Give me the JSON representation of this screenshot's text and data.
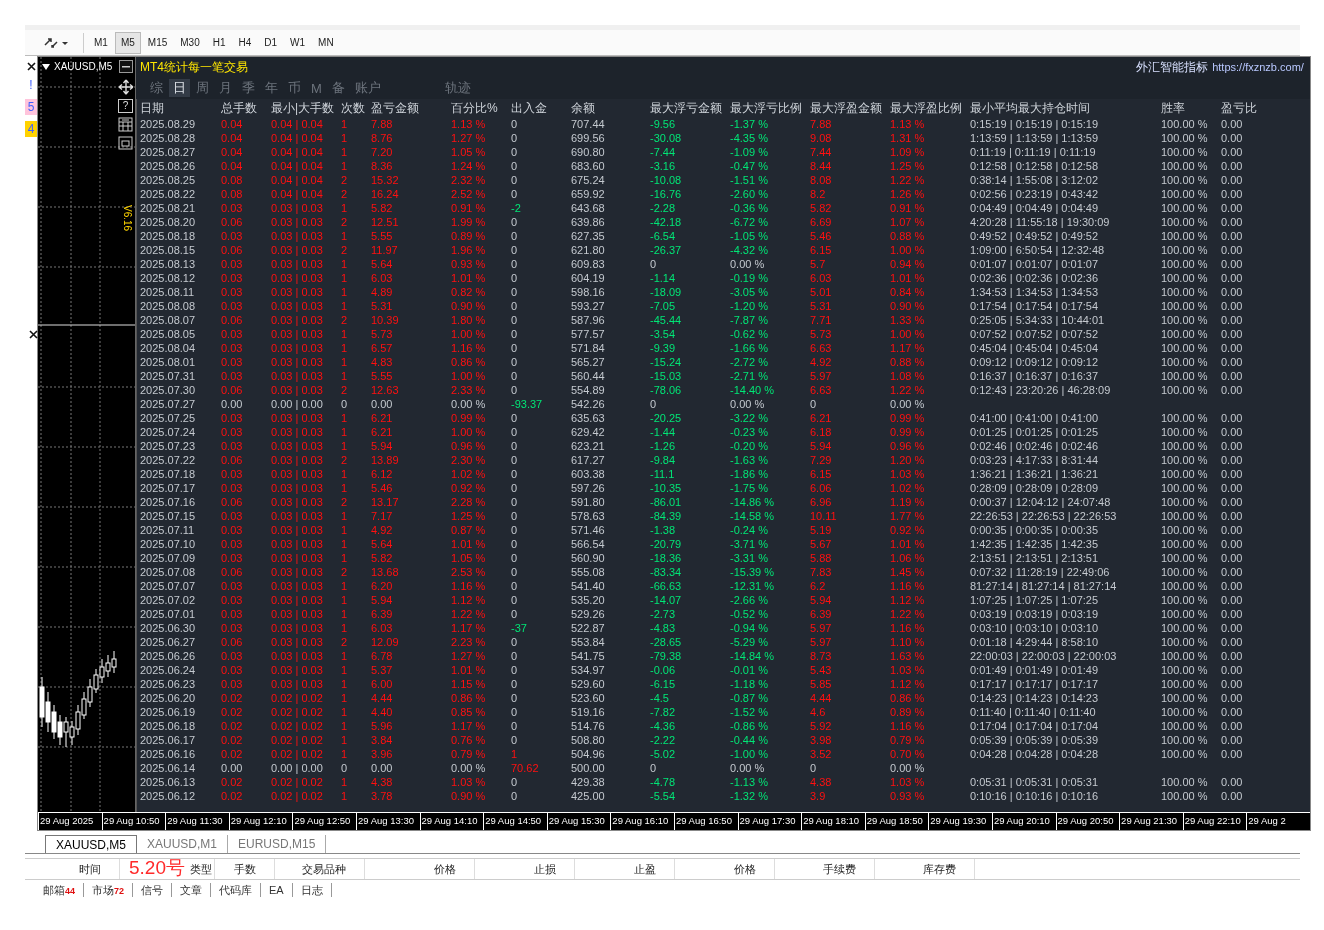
{
  "toolbar": {
    "timeframes": [
      {
        "label": "M1",
        "selected": false
      },
      {
        "label": "M5",
        "selected": true
      },
      {
        "label": "M15",
        "selected": false
      },
      {
        "label": "M30",
        "selected": false
      },
      {
        "label": "H1",
        "selected": false
      },
      {
        "label": "H4",
        "selected": false
      },
      {
        "label": "D1",
        "selected": false
      },
      {
        "label": "W1",
        "selected": false
      },
      {
        "label": "MN",
        "selected": false
      }
    ]
  },
  "side_markers": [
    {
      "label": "!",
      "color": "#ffffff"
    },
    {
      "label": "5",
      "color": "#ffc4dc"
    },
    {
      "label": "4",
      "color": "#ffd200"
    }
  ],
  "chart": {
    "title": "XAUUSD,M5",
    "help": "?",
    "version": "V6.16"
  },
  "panel": {
    "title": "MT4统计每一笔交易",
    "brand": "外汇智能指标",
    "url": "https://fxznzb.com/",
    "tabs": [
      {
        "label": "综",
        "selected": false
      },
      {
        "label": "日",
        "selected": true
      },
      {
        "label": "周",
        "selected": false
      },
      {
        "label": "月",
        "selected": false
      },
      {
        "label": "季",
        "selected": false
      },
      {
        "label": "年",
        "selected": false
      },
      {
        "label": "币",
        "selected": false
      },
      {
        "label": "M",
        "selected": false
      },
      {
        "label": "备",
        "selected": false
      },
      {
        "label": "账户",
        "selected": false
      }
    ],
    "extra_tab": {
      "label": "轨迹",
      "selected": false
    }
  },
  "table": {
    "columns": [
      "日期",
      "总手数",
      "最小|大手数",
      "次数",
      "盈亏金额",
      "百分比%",
      "出入金",
      "余额",
      "最大浮亏金额",
      "最大浮亏比例",
      "最大浮盈金额",
      "最大浮盈比例",
      "最小平均最大持仓时间",
      "胜率",
      "盈亏比"
    ],
    "rows": [
      {
        "kind": "trade",
        "withdrawal": false,
        "deposit": false,
        "drawdown": true,
        "cells": [
          "2025.08.29",
          "0.04",
          "0.04 | 0.04",
          "1",
          "7.88",
          "1.13 %",
          "0",
          "707.44",
          "-9.56",
          "-1.37 %",
          "7.88",
          "1.13 %",
          "0:15:19 | 0:15:19 | 0:15:19",
          "100.00 %",
          "0.00"
        ]
      },
      {
        "kind": "trade",
        "withdrawal": false,
        "deposit": false,
        "drawdown": true,
        "cells": [
          "2025.08.28",
          "0.04",
          "0.04 | 0.04",
          "1",
          "8.76",
          "1.27 %",
          "0",
          "699.56",
          "-30.08",
          "-4.35 %",
          "9.08",
          "1.31 %",
          "1:13:59 | 1:13:59 | 1:13:59",
          "100.00 %",
          "0.00"
        ]
      },
      {
        "kind": "trade",
        "withdrawal": false,
        "deposit": false,
        "drawdown": true,
        "cells": [
          "2025.08.27",
          "0.04",
          "0.04 | 0.04",
          "1",
          "7.20",
          "1.05 %",
          "0",
          "690.80",
          "-7.44",
          "-1.09 %",
          "7.44",
          "1.09 %",
          "0:11:19 | 0:11:19 | 0:11:19",
          "100.00 %",
          "0.00"
        ]
      },
      {
        "kind": "trade",
        "withdrawal": false,
        "deposit": false,
        "drawdown": true,
        "cells": [
          "2025.08.26",
          "0.04",
          "0.04 | 0.04",
          "1",
          "8.36",
          "1.24 %",
          "0",
          "683.60",
          "-3.16",
          "-0.47 %",
          "8.44",
          "1.25 %",
          "0:12:58 | 0:12:58 | 0:12:58",
          "100.00 %",
          "0.00"
        ]
      },
      {
        "kind": "trade",
        "withdrawal": false,
        "deposit": false,
        "drawdown": true,
        "cells": [
          "2025.08.25",
          "0.08",
          "0.04 | 0.04",
          "2",
          "15.32",
          "2.32 %",
          "0",
          "675.24",
          "-10.08",
          "-1.51 %",
          "8.08",
          "1.22 %",
          "0:38:14 | 1:55:08 | 3:12:02",
          "100.00 %",
          "0.00"
        ]
      },
      {
        "kind": "trade",
        "withdrawal": false,
        "deposit": false,
        "drawdown": true,
        "cells": [
          "2025.08.22",
          "0.08",
          "0.04 | 0.04",
          "2",
          "16.24",
          "2.52 %",
          "0",
          "659.92",
          "-16.76",
          "-2.60 %",
          "8.2",
          "1.26 %",
          "0:02:56 | 0:23:19 | 0:43:42",
          "100.00 %",
          "0.00"
        ]
      },
      {
        "kind": "trade",
        "withdrawal": true,
        "deposit": false,
        "drawdown": true,
        "cells": [
          "2025.08.21",
          "0.03",
          "0.03 | 0.03",
          "1",
          "5.82",
          "0.91 %",
          "-2",
          "643.68",
          "-2.28",
          "-0.36 %",
          "5.82",
          "0.91 %",
          "0:04:49 | 0:04:49 | 0:04:49",
          "100.00 %",
          "0.00"
        ]
      },
      {
        "kind": "trade",
        "withdrawal": false,
        "deposit": false,
        "drawdown": true,
        "cells": [
          "2025.08.20",
          "0.06",
          "0.03 | 0.03",
          "2",
          "12.51",
          "1.99 %",
          "0",
          "639.86",
          "-42.18",
          "-6.72 %",
          "6.69",
          "1.07 %",
          "4:20:28 | 11:55:18 | 19:30:09",
          "100.00 %",
          "0.00"
        ]
      },
      {
        "kind": "trade",
        "withdrawal": false,
        "deposit": false,
        "drawdown": true,
        "cells": [
          "2025.08.18",
          "0.03",
          "0.03 | 0.03",
          "1",
          "5.55",
          "0.89 %",
          "0",
          "627.35",
          "-6.54",
          "-1.05 %",
          "5.46",
          "0.88 %",
          "0:49:52 | 0:49:52 | 0:49:52",
          "100.00 %",
          "0.00"
        ]
      },
      {
        "kind": "trade",
        "withdrawal": false,
        "deposit": false,
        "drawdown": true,
        "cells": [
          "2025.08.15",
          "0.06",
          "0.03 | 0.03",
          "2",
          "11.97",
          "1.96 %",
          "0",
          "621.80",
          "-26.37",
          "-4.32 %",
          "6.15",
          "1.00 %",
          "1:09:00 | 6:50:54 | 12:32:48",
          "100.00 %",
          "0.00"
        ]
      },
      {
        "kind": "trade",
        "withdrawal": false,
        "deposit": false,
        "drawdown": false,
        "cells": [
          "2025.08.13",
          "0.03",
          "0.03 | 0.03",
          "1",
          "5.64",
          "0.93 %",
          "0",
          "609.83",
          "0",
          "0.00 %",
          "5.7",
          "0.94 %",
          "0:01:07 | 0:01:07 | 0:01:07",
          "100.00 %",
          "0.00"
        ]
      },
      {
        "kind": "trade",
        "withdrawal": false,
        "deposit": false,
        "drawdown": true,
        "cells": [
          "2025.08.12",
          "0.03",
          "0.03 | 0.03",
          "1",
          "6.03",
          "1.01 %",
          "0",
          "604.19",
          "-1.14",
          "-0.19 %",
          "6.03",
          "1.01 %",
          "0:02:36 | 0:02:36 | 0:02:36",
          "100.00 %",
          "0.00"
        ]
      },
      {
        "kind": "trade",
        "withdrawal": false,
        "deposit": false,
        "drawdown": true,
        "cells": [
          "2025.08.11",
          "0.03",
          "0.03 | 0.03",
          "1",
          "4.89",
          "0.82 %",
          "0",
          "598.16",
          "-18.09",
          "-3.05 %",
          "5.01",
          "0.84 %",
          "1:34:53 | 1:34:53 | 1:34:53",
          "100.00 %",
          "0.00"
        ]
      },
      {
        "kind": "trade",
        "withdrawal": false,
        "deposit": false,
        "drawdown": true,
        "cells": [
          "2025.08.08",
          "0.03",
          "0.03 | 0.03",
          "1",
          "5.31",
          "0.90 %",
          "0",
          "593.27",
          "-7.05",
          "-1.20 %",
          "5.31",
          "0.90 %",
          "0:17:54 | 0:17:54 | 0:17:54",
          "100.00 %",
          "0.00"
        ]
      },
      {
        "kind": "trade",
        "withdrawal": false,
        "deposit": false,
        "drawdown": true,
        "cells": [
          "2025.08.07",
          "0.06",
          "0.03 | 0.03",
          "2",
          "10.39",
          "1.80 %",
          "0",
          "587.96",
          "-45.44",
          "-7.87 %",
          "7.71",
          "1.33 %",
          "0:25:05 | 5:34:33 | 10:44:01",
          "100.00 %",
          "0.00"
        ]
      },
      {
        "kind": "trade",
        "withdrawal": false,
        "deposit": false,
        "drawdown": true,
        "cells": [
          "2025.08.05",
          "0.03",
          "0.03 | 0.03",
          "1",
          "5.73",
          "1.00 %",
          "0",
          "577.57",
          "-3.54",
          "-0.62 %",
          "5.73",
          "1.00 %",
          "0:07:52 | 0:07:52 | 0:07:52",
          "100.00 %",
          "0.00"
        ]
      },
      {
        "kind": "trade",
        "withdrawal": false,
        "deposit": false,
        "drawdown": true,
        "cells": [
          "2025.08.04",
          "0.03",
          "0.03 | 0.03",
          "1",
          "6.57",
          "1.16 %",
          "0",
          "571.84",
          "-9.39",
          "-1.66 %",
          "6.63",
          "1.17 %",
          "0:45:04 | 0:45:04 | 0:45:04",
          "100.00 %",
          "0.00"
        ]
      },
      {
        "kind": "trade",
        "withdrawal": false,
        "deposit": false,
        "drawdown": true,
        "cells": [
          "2025.08.01",
          "0.03",
          "0.03 | 0.03",
          "1",
          "4.83",
          "0.86 %",
          "0",
          "565.27",
          "-15.24",
          "-2.72 %",
          "4.92",
          "0.88 %",
          "0:09:12 | 0:09:12 | 0:09:12",
          "100.00 %",
          "0.00"
        ]
      },
      {
        "kind": "trade",
        "withdrawal": false,
        "deposit": false,
        "drawdown": true,
        "cells": [
          "2025.07.31",
          "0.03",
          "0.03 | 0.03",
          "1",
          "5.55",
          "1.00 %",
          "0",
          "560.44",
          "-15.03",
          "-2.71 %",
          "5.97",
          "1.08 %",
          "0:16:37 | 0:16:37 | 0:16:37",
          "100.00 %",
          "0.00"
        ]
      },
      {
        "kind": "trade",
        "withdrawal": false,
        "deposit": false,
        "drawdown": true,
        "cells": [
          "2025.07.30",
          "0.06",
          "0.03 | 0.03",
          "2",
          "12.63",
          "2.33 %",
          "0",
          "554.89",
          "-78.06",
          "-14.40 %",
          "6.63",
          "1.22 %",
          "0:12:43 | 23:20:26 | 46:28:09",
          "100.00 %",
          "0.00"
        ]
      },
      {
        "kind": "idle",
        "withdrawal": true,
        "deposit": false,
        "drawdown": false,
        "cells": [
          "2025.07.27",
          "0.00",
          "0.00 | 0.00",
          "0",
          "0.00",
          "0.00 %",
          "-93.37",
          "542.26",
          "0",
          "0.00 %",
          "0",
          "0.00 %"
        ]
      },
      {
        "kind": "trade",
        "withdrawal": false,
        "deposit": false,
        "drawdown": true,
        "cells": [
          "2025.07.25",
          "0.03",
          "0.03 | 0.03",
          "1",
          "6.21",
          "0.99 %",
          "0",
          "635.63",
          "-20.25",
          "-3.22 %",
          "6.21",
          "0.99 %",
          "0:41:00 | 0:41:00 | 0:41:00",
          "100.00 %",
          "0.00"
        ]
      },
      {
        "kind": "trade",
        "withdrawal": false,
        "deposit": false,
        "drawdown": true,
        "cells": [
          "2025.07.24",
          "0.03",
          "0.03 | 0.03",
          "1",
          "6.21",
          "1.00 %",
          "0",
          "629.42",
          "-1.44",
          "-0.23 %",
          "6.18",
          "0.99 %",
          "0:01:25 | 0:01:25 | 0:01:25",
          "100.00 %",
          "0.00"
        ]
      },
      {
        "kind": "trade",
        "withdrawal": false,
        "deposit": false,
        "drawdown": true,
        "cells": [
          "2025.07.23",
          "0.03",
          "0.03 | 0.03",
          "1",
          "5.94",
          "0.96 %",
          "0",
          "623.21",
          "-1.26",
          "-0.20 %",
          "5.94",
          "0.96 %",
          "0:02:46 | 0:02:46 | 0:02:46",
          "100.00 %",
          "0.00"
        ]
      },
      {
        "kind": "trade",
        "withdrawal": false,
        "deposit": false,
        "drawdown": true,
        "cells": [
          "2025.07.22",
          "0.06",
          "0.03 | 0.03",
          "2",
          "13.89",
          "2.30 %",
          "0",
          "617.27",
          "-9.84",
          "-1.63 %",
          "7.29",
          "1.20 %",
          "0:03:23 | 4:17:33 | 8:31:44",
          "100.00 %",
          "0.00"
        ]
      },
      {
        "kind": "trade",
        "withdrawal": false,
        "deposit": false,
        "drawdown": true,
        "cells": [
          "2025.07.18",
          "0.03",
          "0.03 | 0.03",
          "1",
          "6.12",
          "1.02 %",
          "0",
          "603.38",
          "-11.1",
          "-1.86 %",
          "6.15",
          "1.03 %",
          "1:36:21 | 1:36:21 | 1:36:21",
          "100.00 %",
          "0.00"
        ]
      },
      {
        "kind": "trade",
        "withdrawal": false,
        "deposit": false,
        "drawdown": true,
        "cells": [
          "2025.07.17",
          "0.03",
          "0.03 | 0.03",
          "1",
          "5.46",
          "0.92 %",
          "0",
          "597.26",
          "-10.35",
          "-1.75 %",
          "6.06",
          "1.02 %",
          "0:28:09 | 0:28:09 | 0:28:09",
          "100.00 %",
          "0.00"
        ]
      },
      {
        "kind": "trade",
        "withdrawal": false,
        "deposit": false,
        "drawdown": true,
        "cells": [
          "2025.07.16",
          "0.06",
          "0.03 | 0.03",
          "2",
          "13.17",
          "2.28 %",
          "0",
          "591.80",
          "-86.01",
          "-14.86 %",
          "6.96",
          "1.19 %",
          "0:00:37 | 12:04:12 | 24:07:48",
          "100.00 %",
          "0.00"
        ]
      },
      {
        "kind": "trade",
        "withdrawal": false,
        "deposit": false,
        "drawdown": true,
        "cells": [
          "2025.07.15",
          "0.03",
          "0.03 | 0.03",
          "1",
          "7.17",
          "1.25 %",
          "0",
          "578.63",
          "-84.39",
          "-14.58 %",
          "10.11",
          "1.77 %",
          "22:26:53 | 22:26:53 | 22:26:53",
          "100.00 %",
          "0.00"
        ]
      },
      {
        "kind": "trade",
        "withdrawal": false,
        "deposit": false,
        "drawdown": true,
        "cells": [
          "2025.07.11",
          "0.03",
          "0.03 | 0.03",
          "1",
          "4.92",
          "0.87 %",
          "0",
          "571.46",
          "-1.38",
          "-0.24 %",
          "5.19",
          "0.92 %",
          "0:00:35 | 0:00:35 | 0:00:35",
          "100.00 %",
          "0.00"
        ]
      },
      {
        "kind": "trade",
        "withdrawal": false,
        "deposit": false,
        "drawdown": true,
        "cells": [
          "2025.07.10",
          "0.03",
          "0.03 | 0.03",
          "1",
          "5.64",
          "1.01 %",
          "0",
          "566.54",
          "-20.79",
          "-3.71 %",
          "5.67",
          "1.01 %",
          "1:42:35 | 1:42:35 | 1:42:35",
          "100.00 %",
          "0.00"
        ]
      },
      {
        "kind": "trade",
        "withdrawal": false,
        "deposit": false,
        "drawdown": true,
        "cells": [
          "2025.07.09",
          "0.03",
          "0.03 | 0.03",
          "1",
          "5.82",
          "1.05 %",
          "0",
          "560.90",
          "-18.36",
          "-3.31 %",
          "5.88",
          "1.06 %",
          "2:13:51 | 2:13:51 | 2:13:51",
          "100.00 %",
          "0.00"
        ]
      },
      {
        "kind": "trade",
        "withdrawal": false,
        "deposit": false,
        "drawdown": true,
        "cells": [
          "2025.07.08",
          "0.06",
          "0.03 | 0.03",
          "2",
          "13.68",
          "2.53 %",
          "0",
          "555.08",
          "-83.34",
          "-15.39 %",
          "7.83",
          "1.45 %",
          "0:07:32 | 11:28:19 | 22:49:06",
          "100.00 %",
          "0.00"
        ]
      },
      {
        "kind": "trade",
        "withdrawal": false,
        "deposit": false,
        "drawdown": true,
        "cells": [
          "2025.07.07",
          "0.03",
          "0.03 | 0.03",
          "1",
          "6.20",
          "1.16 %",
          "0",
          "541.40",
          "-66.63",
          "-12.31 %",
          "6.2",
          "1.16 %",
          "81:27:14 | 81:27:14 | 81:27:14",
          "100.00 %",
          "0.00"
        ]
      },
      {
        "kind": "trade",
        "withdrawal": false,
        "deposit": false,
        "drawdown": true,
        "cells": [
          "2025.07.02",
          "0.03",
          "0.03 | 0.03",
          "1",
          "5.94",
          "1.12 %",
          "0",
          "535.20",
          "-14.07",
          "-2.66 %",
          "5.94",
          "1.12 %",
          "1:07:25 | 1:07:25 | 1:07:25",
          "100.00 %",
          "0.00"
        ]
      },
      {
        "kind": "trade",
        "withdrawal": false,
        "deposit": false,
        "drawdown": true,
        "cells": [
          "2025.07.01",
          "0.03",
          "0.03 | 0.03",
          "1",
          "6.39",
          "1.22 %",
          "0",
          "529.26",
          "-2.73",
          "-0.52 %",
          "6.39",
          "1.22 %",
          "0:03:19 | 0:03:19 | 0:03:19",
          "100.00 %",
          "0.00"
        ]
      },
      {
        "kind": "trade",
        "withdrawal": true,
        "deposit": false,
        "drawdown": true,
        "cells": [
          "2025.06.30",
          "0.03",
          "0.03 | 0.03",
          "1",
          "6.03",
          "1.17 %",
          "-37",
          "522.87",
          "-4.83",
          "-0.94 %",
          "5.97",
          "1.16 %",
          "0:03:10 | 0:03:10 | 0:03:10",
          "100.00 %",
          "0.00"
        ]
      },
      {
        "kind": "trade",
        "withdrawal": false,
        "deposit": false,
        "drawdown": true,
        "cells": [
          "2025.06.27",
          "0.06",
          "0.03 | 0.03",
          "2",
          "12.09",
          "2.23 %",
          "0",
          "553.84",
          "-28.65",
          "-5.29 %",
          "5.97",
          "1.10 %",
          "0:01:18 | 4:29:44 | 8:58:10",
          "100.00 %",
          "0.00"
        ]
      },
      {
        "kind": "trade",
        "withdrawal": false,
        "deposit": false,
        "drawdown": true,
        "cells": [
          "2025.06.26",
          "0.03",
          "0.03 | 0.03",
          "1",
          "6.78",
          "1.27 %",
          "0",
          "541.75",
          "-79.38",
          "-14.84 %",
          "8.73",
          "1.63 %",
          "22:00:03 | 22:00:03 | 22:00:03",
          "100.00 %",
          "0.00"
        ]
      },
      {
        "kind": "trade",
        "withdrawal": false,
        "deposit": false,
        "drawdown": true,
        "cells": [
          "2025.06.24",
          "0.03",
          "0.03 | 0.03",
          "1",
          "5.37",
          "1.01 %",
          "0",
          "534.97",
          "-0.06",
          "-0.01 %",
          "5.43",
          "1.03 %",
          "0:01:49 | 0:01:49 | 0:01:49",
          "100.00 %",
          "0.00"
        ]
      },
      {
        "kind": "trade",
        "withdrawal": false,
        "deposit": false,
        "drawdown": true,
        "cells": [
          "2025.06.23",
          "0.03",
          "0.03 | 0.03",
          "1",
          "6.00",
          "1.15 %",
          "0",
          "529.60",
          "-6.15",
          "-1.18 %",
          "5.85",
          "1.12 %",
          "0:17:17 | 0:17:17 | 0:17:17",
          "100.00 %",
          "0.00"
        ]
      },
      {
        "kind": "trade",
        "withdrawal": false,
        "deposit": false,
        "drawdown": true,
        "cells": [
          "2025.06.20",
          "0.02",
          "0.02 | 0.02",
          "1",
          "4.44",
          "0.86 %",
          "0",
          "523.60",
          "-4.5",
          "-0.87 %",
          "4.44",
          "0.86 %",
          "0:14:23 | 0:14:23 | 0:14:23",
          "100.00 %",
          "0.00"
        ]
      },
      {
        "kind": "trade",
        "withdrawal": false,
        "deposit": false,
        "drawdown": true,
        "cells": [
          "2025.06.19",
          "0.02",
          "0.02 | 0.02",
          "1",
          "4.40",
          "0.85 %",
          "0",
          "519.16",
          "-7.82",
          "-1.52 %",
          "4.6",
          "0.89 %",
          "0:11:40 | 0:11:40 | 0:11:40",
          "100.00 %",
          "0.00"
        ]
      },
      {
        "kind": "trade",
        "withdrawal": false,
        "deposit": false,
        "drawdown": true,
        "cells": [
          "2025.06.18",
          "0.02",
          "0.02 | 0.02",
          "1",
          "5.96",
          "1.17 %",
          "0",
          "514.76",
          "-4.36",
          "-0.86 %",
          "5.92",
          "1.16 %",
          "0:17:04 | 0:17:04 | 0:17:04",
          "100.00 %",
          "0.00"
        ]
      },
      {
        "kind": "trade",
        "withdrawal": false,
        "deposit": false,
        "drawdown": true,
        "cells": [
          "2025.06.17",
          "0.02",
          "0.02 | 0.02",
          "1",
          "3.84",
          "0.76 %",
          "0",
          "508.80",
          "-2.22",
          "-0.44 %",
          "3.98",
          "0.79 %",
          "0:05:39 | 0:05:39 | 0:05:39",
          "100.00 %",
          "0.00"
        ]
      },
      {
        "kind": "trade",
        "withdrawal": false,
        "deposit": true,
        "drawdown": true,
        "cells": [
          "2025.06.16",
          "0.02",
          "0.02 | 0.02",
          "1",
          "3.96",
          "0.79 %",
          "1",
          "504.96",
          "-5.02",
          "-1.00 %",
          "3.52",
          "0.70 %",
          "0:04:28 | 0:04:28 | 0:04:28",
          "100.00 %",
          "0.00"
        ]
      },
      {
        "kind": "idle",
        "withdrawal": false,
        "deposit": true,
        "drawdown": false,
        "cells": [
          "2025.06.14",
          "0.00",
          "0.00 | 0.00",
          "0",
          "0.00",
          "0.00 %",
          "70.62",
          "500.00",
          "0",
          "0.00 %",
          "0",
          "0.00 %"
        ]
      },
      {
        "kind": "trade",
        "withdrawal": false,
        "deposit": false,
        "drawdown": true,
        "cells": [
          "2025.06.13",
          "0.02",
          "0.02 | 0.02",
          "1",
          "4.38",
          "1.03 %",
          "0",
          "429.38",
          "-4.78",
          "-1.13 %",
          "4.38",
          "1.03 %",
          "0:05:31 | 0:05:31 | 0:05:31",
          "100.00 %",
          "0.00"
        ]
      },
      {
        "kind": "trade",
        "withdrawal": false,
        "deposit": false,
        "drawdown": true,
        "cells": [
          "2025.06.12",
          "0.02",
          "0.02 | 0.02",
          "1",
          "3.78",
          "0.90 %",
          "0",
          "425.00",
          "-5.54",
          "-1.32 %",
          "3.9",
          "0.93 %",
          "0:10:16 | 0:10:16 | 0:10:16",
          "100.00 %",
          "0.00"
        ]
      }
    ]
  },
  "time_axis": [
    "29 Aug 2025",
    "29 Aug 10:50",
    "29 Aug 11:30",
    "29 Aug 12:10",
    "29 Aug 12:50",
    "29 Aug 13:30",
    "29 Aug 14:10",
    "29 Aug 14:50",
    "29 Aug 15:30",
    "29 Aug 16:10",
    "29 Aug 16:50",
    "29 Aug 17:30",
    "29 Aug 18:10",
    "29 Aug 18:50",
    "29 Aug 19:30",
    "29 Aug 20:10",
    "29 Aug 20:50",
    "29 Aug 21:30",
    "29 Aug 22:10",
    "29 Aug 2"
  ],
  "chart_tabs": [
    {
      "label": "XAUUSD,M5",
      "selected": true
    },
    {
      "label": "XAUUSD,M1",
      "selected": false
    },
    {
      "label": "EURUSD,M15",
      "selected": false
    }
  ],
  "terminal": {
    "annotation": "5.20号",
    "columns": [
      "时间",
      "类型",
      "手数",
      "交易品种",
      "价格",
      "止损",
      "止盈",
      "价格",
      "手续费",
      "库存费"
    ],
    "tabs": [
      {
        "label": "邮箱",
        "count": "44"
      },
      {
        "label": "市场",
        "count": "72"
      },
      {
        "label": "信号"
      },
      {
        "label": "文章"
      },
      {
        "label": "代码库"
      },
      {
        "label": "EA"
      },
      {
        "label": "日志"
      }
    ]
  }
}
